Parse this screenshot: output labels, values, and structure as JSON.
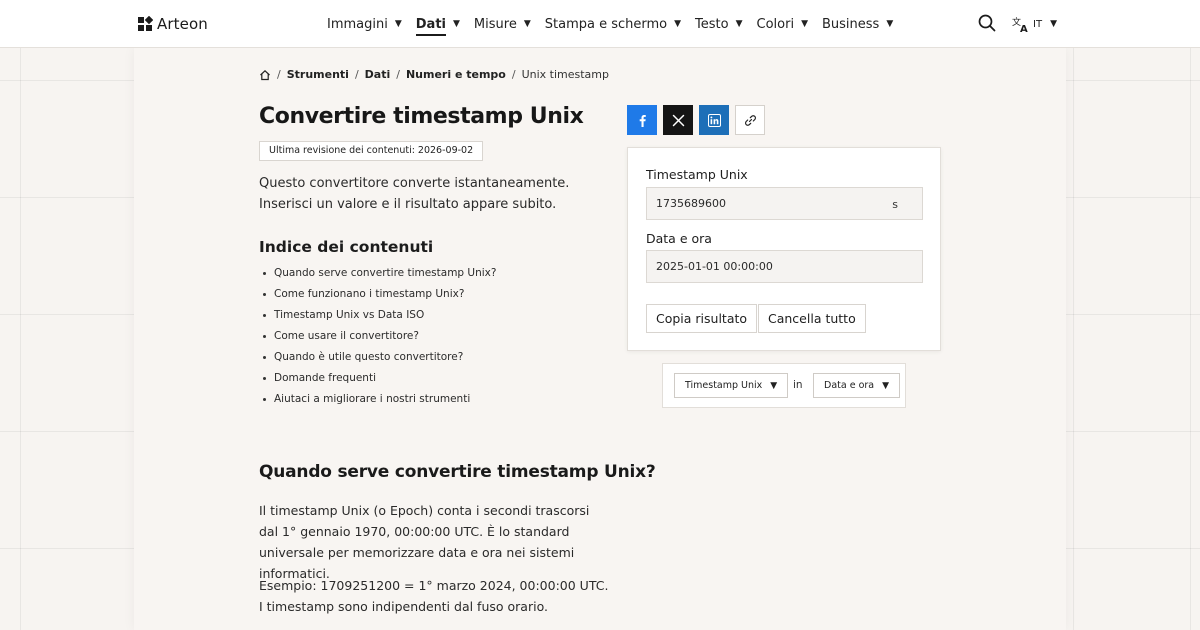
{
  "header": {
    "logo_text": "Arteon",
    "nav": [
      {
        "label": "Immagini",
        "active": false
      },
      {
        "label": "Dati",
        "active": true
      },
      {
        "label": "Misure",
        "active": false
      },
      {
        "label": "Stampa e schermo",
        "active": false
      },
      {
        "label": "Testo",
        "active": false
      },
      {
        "label": "Colori",
        "active": false
      },
      {
        "label": "Business",
        "active": false
      }
    ],
    "search_icon": "search-icon",
    "language": {
      "icon": "translate-icon",
      "code": "IT"
    }
  },
  "breadcrumb": {
    "home_icon": "home-icon",
    "items": [
      "Strumenti",
      "Dati",
      "Numeri e tempo"
    ],
    "current": "Unix timestamp"
  },
  "article": {
    "title": "Convertire timestamp Unix",
    "revision": "Ultima revisione dei contenuti: 2026-09-02",
    "intro": "Questo convertitore converte istantaneamente. Inserisci un valore e il risultato appare subito.",
    "toc_title": "Indice dei contenuti",
    "toc": [
      "Quando serve convertire timestamp Unix?",
      "Come funzionano i timestamp Unix?",
      "Timestamp Unix vs Data ISO",
      "Come usare il convertitore?",
      "Quando è utile questo convertitore?",
      "Domande frequenti",
      "Aiutaci a migliorare i nostri strumenti"
    ],
    "section_title": "Quando serve convertire timestamp Unix?",
    "section_p1": "Il timestamp Unix (o Epoch) conta i secondi trascorsi dal 1° gennaio 1970, 00:00:00 UTC. È lo standard universale per memorizzare data e ora nei sistemi informatici.",
    "section_p2": "Esempio: 1709251200 = 1° marzo 2024, 00:00:00 UTC. I timestamp sono indipendenti dal fuso orario."
  },
  "share": {
    "buttons": [
      "facebook-icon",
      "x-icon",
      "linkedin-icon",
      "link-icon"
    ],
    "colors": {
      "facebook": "#1f7ae8",
      "x": "#151515",
      "linkedin": "#1d6fb8"
    }
  },
  "converter": {
    "input_label": "Timestamp Unix",
    "input_value": "1735689600",
    "input_unit": "s",
    "output_label": "Data e ora",
    "output_value": "2025-01-01 00:00:00",
    "copy_label": "Copia risultato",
    "clear_label": "Cancella tutto"
  },
  "unit_selector": {
    "from": "Timestamp Unix",
    "connector": "in",
    "to": "Data e ora"
  }
}
